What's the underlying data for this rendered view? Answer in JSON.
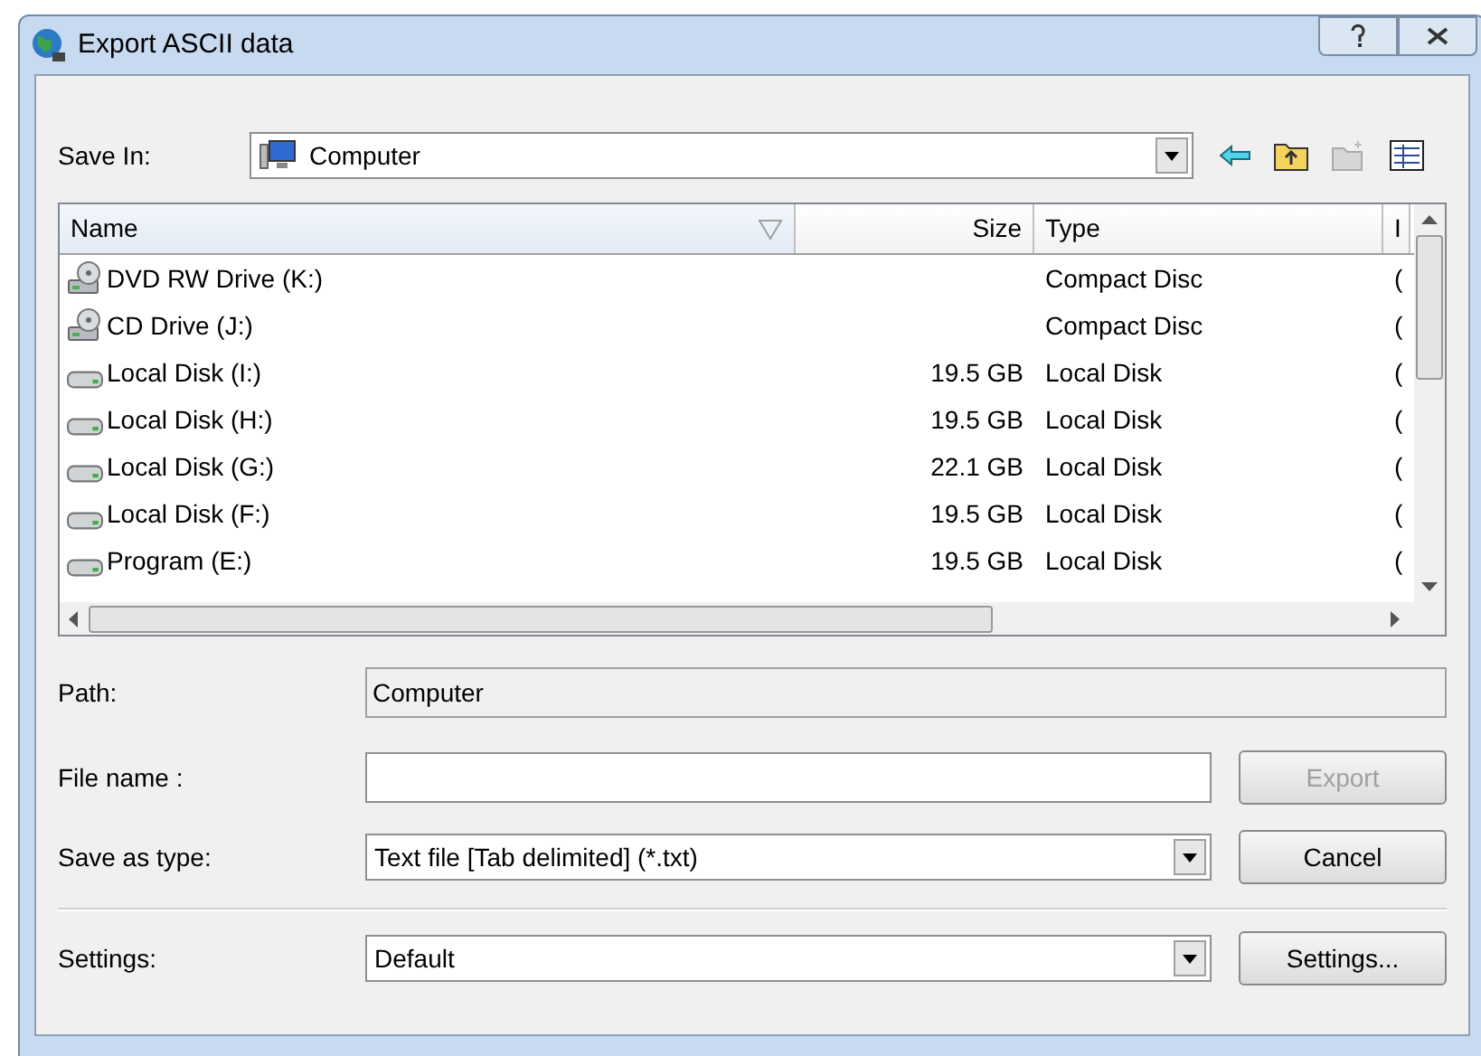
{
  "window": {
    "title": "Export ASCII data"
  },
  "save_in": {
    "label": "Save In:",
    "value": "Computer"
  },
  "file_list": {
    "columns": [
      {
        "label": "Name",
        "sorted": true
      },
      {
        "label": "Size",
        "sorted": false
      },
      {
        "label": "Type",
        "sorted": false
      },
      {
        "label": "I",
        "sorted": false
      }
    ],
    "rows": [
      {
        "kind": "optical",
        "name": "DVD RW Drive (K:)",
        "size": "",
        "type": "Compact Disc",
        "column_4": "("
      },
      {
        "kind": "optical",
        "name": "CD Drive (J:)",
        "size": "",
        "type": "Compact Disc",
        "column_4": "("
      },
      {
        "kind": "disk",
        "name": "Local Disk (I:)",
        "size": "19.5 GB",
        "type": "Local Disk",
        "column_4": "("
      },
      {
        "kind": "disk",
        "name": "Local Disk (H:)",
        "size": "19.5 GB",
        "type": "Local Disk",
        "column_4": "("
      },
      {
        "kind": "disk",
        "name": "Local Disk (G:)",
        "size": "22.1 GB",
        "type": "Local Disk",
        "column_4": "("
      },
      {
        "kind": "disk",
        "name": "Local Disk (F:)",
        "size": "19.5 GB",
        "type": "Local Disk",
        "column_4": "("
      },
      {
        "kind": "disk",
        "name": "Program (E:)",
        "size": "19.5 GB",
        "type": "Local Disk",
        "column_4": "("
      }
    ]
  },
  "path": {
    "label": "Path:",
    "value": "Computer"
  },
  "file_name": {
    "label": "File name :"
  },
  "export_button": {
    "label": "Export",
    "disabled": true
  },
  "save_as_type": {
    "label": "Save as type:",
    "value": "Text file [Tab delimited] (*.txt)"
  },
  "cancel_button": {
    "label": "Cancel",
    "disabled": false
  },
  "settings": {
    "label": "Settings:",
    "value": "Default"
  },
  "settings_button": {
    "label": "Settings...",
    "disabled": false
  }
}
